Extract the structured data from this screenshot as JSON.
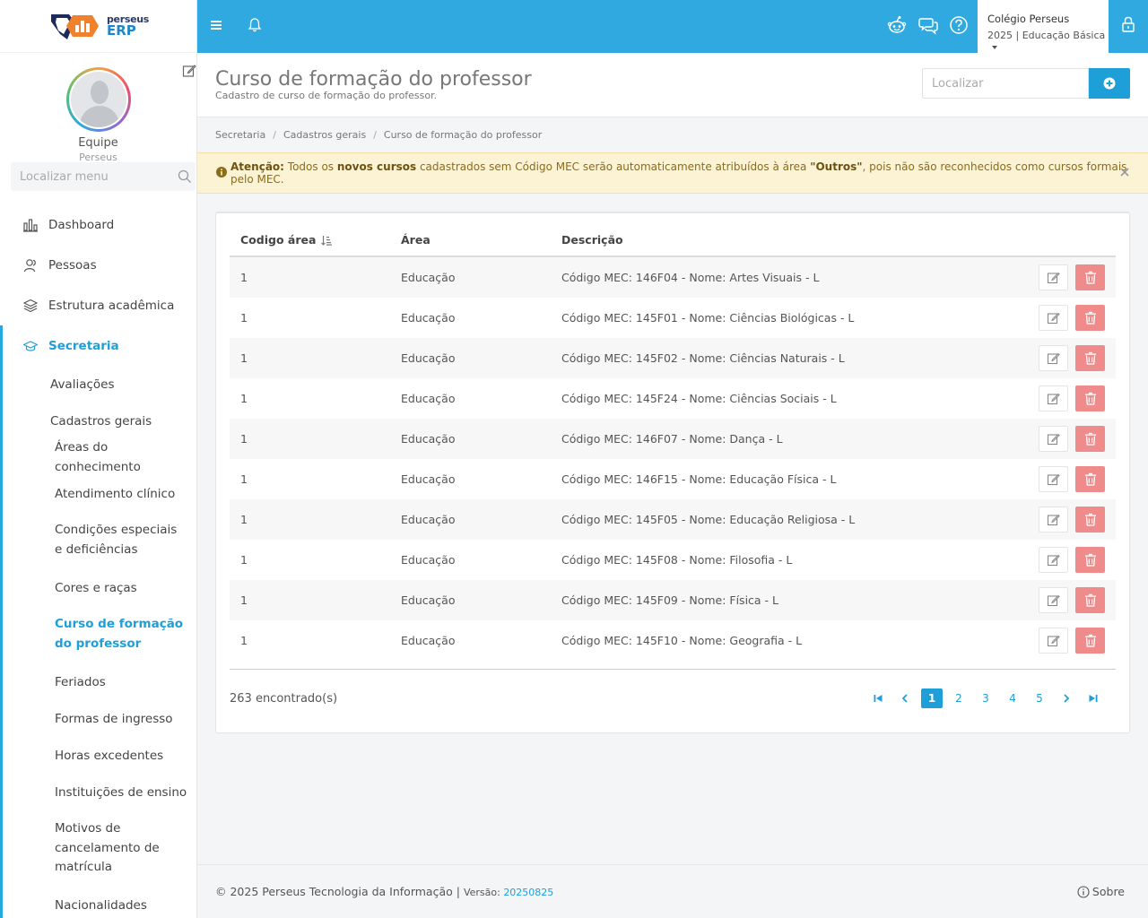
{
  "brand": {
    "line1": "perseus",
    "line2": "ERP"
  },
  "profile": {
    "name": "Equipe",
    "role": "Perseus"
  },
  "menu_search": {
    "placeholder": "Localizar menu"
  },
  "nav": {
    "dashboard": "Dashboard",
    "pessoas": "Pessoas",
    "estrutura": "Estrutura acadêmica",
    "secretaria": "Secretaria",
    "avaliacoes": "Avaliações",
    "cadastros": "Cadastros gerais",
    "sub": [
      "Áreas do conhecimento",
      "Atendimento clínico",
      "Condições especiais e deficiências",
      "Cores e raças",
      "Curso de formação do professor",
      "Feriados",
      "Formas de ingresso",
      "Horas excedentes",
      "Instituições de ensino",
      "Motivos de cancelamento de matrícula",
      "Nacionalidades"
    ]
  },
  "school": {
    "name": "Colégio Perseus",
    "period": "2025 | Educação Básica"
  },
  "page": {
    "title": "Curso de formação do professor",
    "subtitle": "Cadastro de curso de formação do professor."
  },
  "search": {
    "placeholder": "Localizar"
  },
  "breadcrumb": [
    "Secretaria",
    "Cadastros gerais",
    "Curso de formação do professor"
  ],
  "alert": {
    "prefix": "Atenção:",
    "t1": " Todos os ",
    "b1": "novos cursos",
    "t2": " cadastrados sem Código MEC serão automaticamente atribuídos à área ",
    "b2": "\"Outros\"",
    "t3": ", pois não são reconhecidos como cursos formais pelo MEC."
  },
  "table": {
    "headers": [
      "Codigo área",
      "Área",
      "Descrição"
    ],
    "rows": [
      [
        "1",
        "Educação",
        "Código MEC: 146F04 - Nome: Artes Visuais - L"
      ],
      [
        "1",
        "Educação",
        "Código MEC: 145F01 - Nome: Ciências Biológicas - L"
      ],
      [
        "1",
        "Educação",
        "Código MEC: 145F02 - Nome: Ciências Naturais - L"
      ],
      [
        "1",
        "Educação",
        "Código MEC: 145F24 - Nome: Ciências Sociais - L"
      ],
      [
        "1",
        "Educação",
        "Código MEC: 146F07 - Nome: Dança - L"
      ],
      [
        "1",
        "Educação",
        "Código MEC: 146F15 - Nome: Educação Física - L"
      ],
      [
        "1",
        "Educação",
        "Código MEC: 145F05 - Nome: Educação Religiosa - L"
      ],
      [
        "1",
        "Educação",
        "Código MEC: 145F08 - Nome: Filosofia - L"
      ],
      [
        "1",
        "Educação",
        "Código MEC: 145F09 - Nome: Física - L"
      ],
      [
        "1",
        "Educação",
        "Código MEC: 145F10 - Nome: Geografia - L"
      ]
    ]
  },
  "pagination": {
    "found": "263 encontrado(s)",
    "pages": [
      "1",
      "2",
      "3",
      "4",
      "5"
    ],
    "current": "1"
  },
  "footer": {
    "copyright": "© 2025 Perseus Tecnologia da Informação",
    "version_label": "Versão:",
    "version": "20250825",
    "about": "Sobre"
  },
  "colors": {
    "accent": "#2fa9e0",
    "primary": "#1e9fd8",
    "danger": "#ef8b8b",
    "warning_bg": "#fcf3d5"
  }
}
